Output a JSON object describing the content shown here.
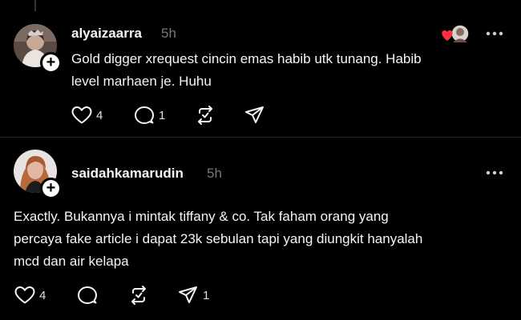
{
  "posts": [
    {
      "username": "alyaizaarra",
      "time": "5h",
      "text_line1": "Gold digger xrequest cincin emas habib utk tunang. Habib",
      "text_line2": "level marhaen je. Huhu",
      "likes": "4",
      "replies": "1",
      "reposts": "",
      "shares": "",
      "avatar_icon": "avatar-alyaizaarra",
      "liked_by_icon": "heart-avatar-icon"
    },
    {
      "username": "saidahkamarudin",
      "time": "5h",
      "text_line1": "Exactly. Bukannya i mintak tiffany & co. Tak faham orang yang",
      "text_line2": "percaya fake article i dapat 23k sebulan tapi yang diungkit hanyalah",
      "text_line3": "mcd dan air kelapa",
      "likes": "4",
      "replies": "",
      "reposts": "",
      "shares": "1",
      "avatar_icon": "avatar-saidahkamarudin"
    }
  ],
  "icons": {
    "like": "heart-icon",
    "reply": "comment-icon",
    "repost": "repost-icon",
    "share": "send-icon",
    "more": "more-icon",
    "follow": "plus-icon"
  },
  "colors": {
    "background": "#000000",
    "text": "#f3f5f7",
    "secondary": "#777777",
    "like_red": "#ff3040"
  }
}
